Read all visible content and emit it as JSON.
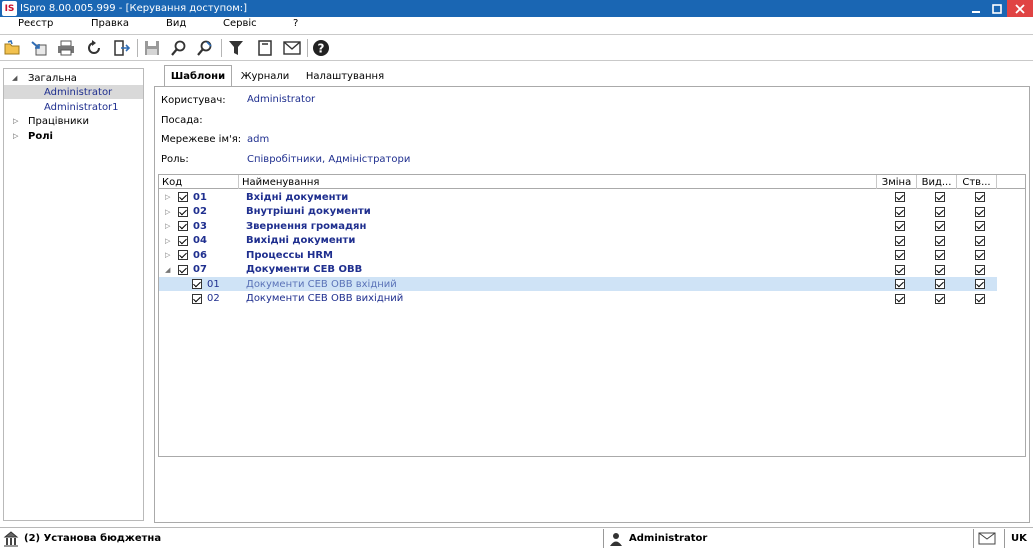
{
  "window": {
    "title": "ISpro 8.00.005.999 - [Керування доступом:]",
    "logo": "IS"
  },
  "menu": [
    "Реєстр",
    "Правка",
    "Вид",
    "Сервіс",
    "?"
  ],
  "toolbar": {
    "icons": [
      "open-folder-icon",
      "import-icon",
      "print-icon",
      "refresh-icon",
      "exit-icon",
      "save-icon",
      "search-icon",
      "search-next-icon",
      "filter-icon",
      "document-icon",
      "mail-icon",
      "help-icon"
    ]
  },
  "sidebar": {
    "items": [
      {
        "label": "Загальна",
        "expanded": true
      },
      {
        "label": "Administrator",
        "selected": true
      },
      {
        "label": "Administrator1"
      },
      {
        "label": "Працівники",
        "expanded": false
      },
      {
        "label": "Ролі",
        "expanded": false
      }
    ]
  },
  "tabs": [
    {
      "label": "Шаблони",
      "active": true
    },
    {
      "label": "Журнали"
    },
    {
      "label": "Налаштування"
    }
  ],
  "info": {
    "user_label": "Користувач:",
    "user_value": "Administrator",
    "position_label": "Посада:",
    "position_value": "",
    "netname_label": "Мережеве ім'я:",
    "netname_value": "adm",
    "role_label": "Роль:",
    "role_value": "Співробітники, Адміністратори"
  },
  "grid": {
    "columns": [
      "Код",
      "Найменування",
      "Зміна",
      "Вид...",
      "Ств..."
    ],
    "rows": [
      {
        "code": "01",
        "name": "Вхідні документи",
        "level": 0,
        "expanded": false
      },
      {
        "code": "02",
        "name": "Внутрішні  документи",
        "level": 0,
        "expanded": false
      },
      {
        "code": "03",
        "name": "Звернення громадян",
        "level": 0,
        "expanded": false
      },
      {
        "code": "04",
        "name": "Вихідні документи",
        "level": 0,
        "expanded": false
      },
      {
        "code": "06",
        "name": "Процессы HRM",
        "level": 0,
        "expanded": false
      },
      {
        "code": "07",
        "name": "Документи СЕВ ОВВ",
        "level": 0,
        "expanded": true
      },
      {
        "code": "01",
        "name": "Документи СЕВ ОВВ вхідний",
        "level": 1,
        "selected": true
      },
      {
        "code": "02",
        "name": "Документи СЕВ ОВВ вихідний",
        "level": 1
      }
    ]
  },
  "status": {
    "org": "(2) Установа бюджетна",
    "user": "Administrator",
    "lang": "UK"
  }
}
